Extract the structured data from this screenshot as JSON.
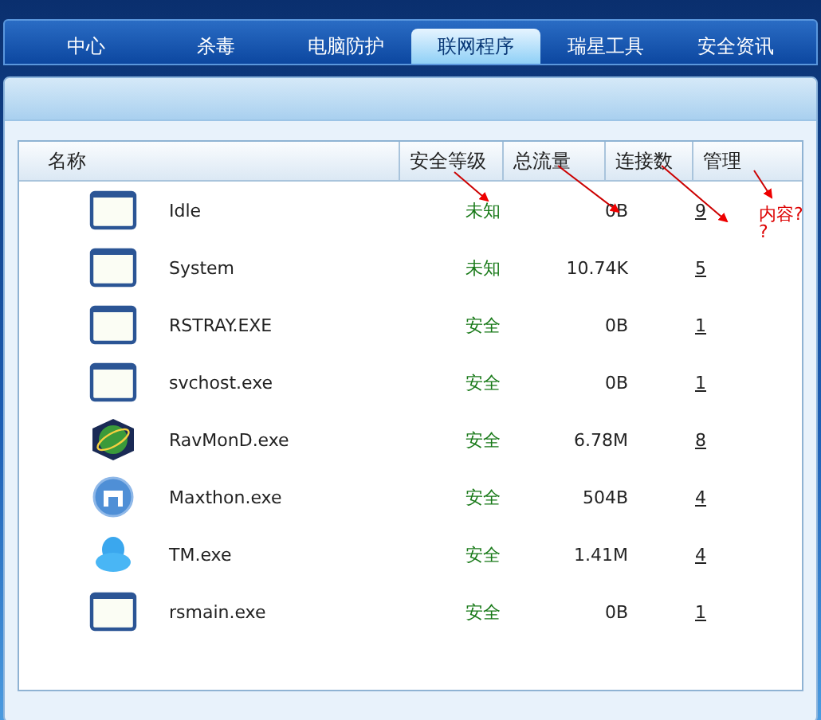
{
  "tabs": [
    {
      "label": "中心",
      "selected": false
    },
    {
      "label": "杀毒",
      "selected": false
    },
    {
      "label": "电脑防护",
      "selected": false
    },
    {
      "label": "联网程序",
      "selected": true
    },
    {
      "label": "瑞星工具",
      "selected": false
    },
    {
      "label": "安全资讯",
      "selected": false
    }
  ],
  "table": {
    "columns": [
      "名称",
      "安全等级",
      "总流量",
      "连接数",
      "管理"
    ],
    "rows": [
      {
        "kind": "window",
        "name": "Idle",
        "level": "未知",
        "traffic": "0B",
        "connections": "9"
      },
      {
        "kind": "window",
        "name": "System",
        "level": "未知",
        "traffic": "10.74K",
        "connections": "5"
      },
      {
        "kind": "window",
        "name": "RSTRAY.EXE",
        "level": "安全",
        "traffic": "0B",
        "connections": "1"
      },
      {
        "kind": "window",
        "name": "svchost.exe",
        "level": "安全",
        "traffic": "0B",
        "connections": "1"
      },
      {
        "kind": "globe",
        "name": "RavMonD.exe",
        "level": "安全",
        "traffic": "6.78M",
        "connections": "8"
      },
      {
        "kind": "browser",
        "name": "Maxthon.exe",
        "level": "安全",
        "traffic": "504B",
        "connections": "4"
      },
      {
        "kind": "penguin",
        "name": "TM.exe",
        "level": "安全",
        "traffic": "1.41M",
        "connections": "4"
      },
      {
        "kind": "window",
        "name": "rsmain.exe",
        "level": "安全",
        "traffic": "0B",
        "connections": "1"
      }
    ]
  },
  "annotation": {
    "lines": [
      "内容?",
      "?"
    ]
  }
}
